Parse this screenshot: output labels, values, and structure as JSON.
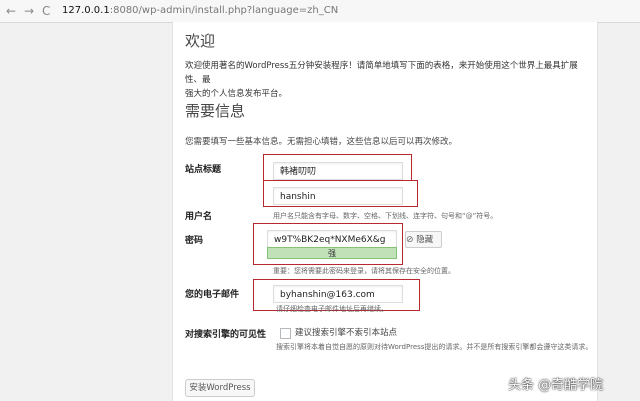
{
  "browser": {
    "back_glyph": "←",
    "forward_glyph": "→",
    "reload_glyph": "C",
    "url_host": "127.0.0.1",
    "url_path": ":8080/wp-admin/install.php?language=zh_CN"
  },
  "welcome": {
    "heading": "欢迎",
    "text_line1": "欢迎使用著名的WordPress五分钟安装程序！请简单地填写下面的表格，来开始使用这个世界上最具扩展性、最",
    "text_line2": "强大的个人信息发布平台。"
  },
  "info": {
    "heading": "需要信息",
    "intro": "您需要填写一些基本信息。无需担心填错，这些信息以后可以再次修改。"
  },
  "form": {
    "site_title": {
      "label": "站点标题",
      "value": "韩褚叨叨"
    },
    "username": {
      "label": "用户名",
      "value": "hanshin",
      "hint": "用户名只能含有字母、数字、空格、下划线、连字符、句号和“@”符号。"
    },
    "password": {
      "label": "密码",
      "value": "w9T%BK2eq*NXMe6X&g",
      "strength": "强",
      "hide_label": "隐藏",
      "hint": "重要：您将需要此密码来登录，请将其保存在安全的位置。"
    },
    "email": {
      "label": "您的电子邮件",
      "value": "byhanshin@163.com",
      "hint": "请仔细检查电子邮件地址后再继续。"
    },
    "search_visibility": {
      "label": "对搜索引擎的可见性",
      "checkbox_label": "建议搜索引擎不索引本站点",
      "checked": false,
      "hint": "搜索引擎将本着自觉自愿的原则对待WordPress提出的请求。并不是所有搜索引擎都会遵守这类请求。"
    }
  },
  "submit_label": "安装WordPress",
  "watermark": "头条 @奇酷学院",
  "colors": {
    "highlight_border": "#b5292f",
    "strength_bg": "#c1e1b9"
  }
}
